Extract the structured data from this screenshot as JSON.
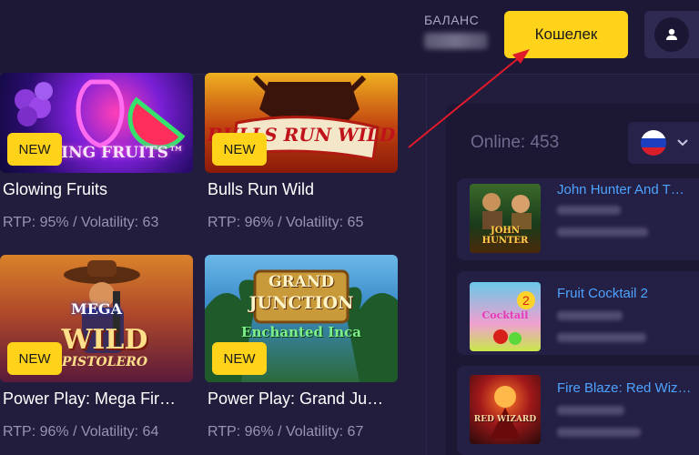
{
  "header": {
    "balance_label": "БАЛАНС",
    "wallet_button": "Кошелек"
  },
  "games": [
    {
      "title": "Glowing Fruits",
      "meta": "RTP: 95% / Volatility: 63",
      "badge": "NEW",
      "art_text": "WING FRUITS™"
    },
    {
      "title": "Bulls Run Wild",
      "meta": "RTP: 96% / Volatility: 65",
      "badge": "NEW",
      "art_text": "BULLS RUN WILD"
    },
    {
      "title": "Power Play: Mega Fir…",
      "meta": "RTP: 96% / Volatility: 64",
      "badge": "NEW",
      "art_text_1": "MEGA",
      "art_text_2": "WILD",
      "art_text_3": "PISTOLERO"
    },
    {
      "title": "Power Play: Grand Ju…",
      "meta": "RTP: 96% / Volatility: 67",
      "badge": "NEW",
      "art_text_1": "GRAND",
      "art_text_2": "JUNCTION",
      "art_text_3": "Enchanted Inca"
    }
  ],
  "sidebar": {
    "online": "Online: 453",
    "feed": [
      {
        "title": "John Hunter And T…",
        "art_text": "JOHN HUNTER"
      },
      {
        "title": "Fruit Cocktail 2",
        "art_text": "Cocktail"
      },
      {
        "title": "Fire Blaze: Red Wiz…",
        "art_text": "RED WIZARD"
      }
    ]
  },
  "colors": {
    "accent": "#ffd31a",
    "background": "#221d3d",
    "link": "#4ea3ff",
    "annotation_arrow": "#e0192b"
  },
  "icons": [
    "user-icon",
    "chevron-down-icon",
    "russian-flag-icon"
  ]
}
